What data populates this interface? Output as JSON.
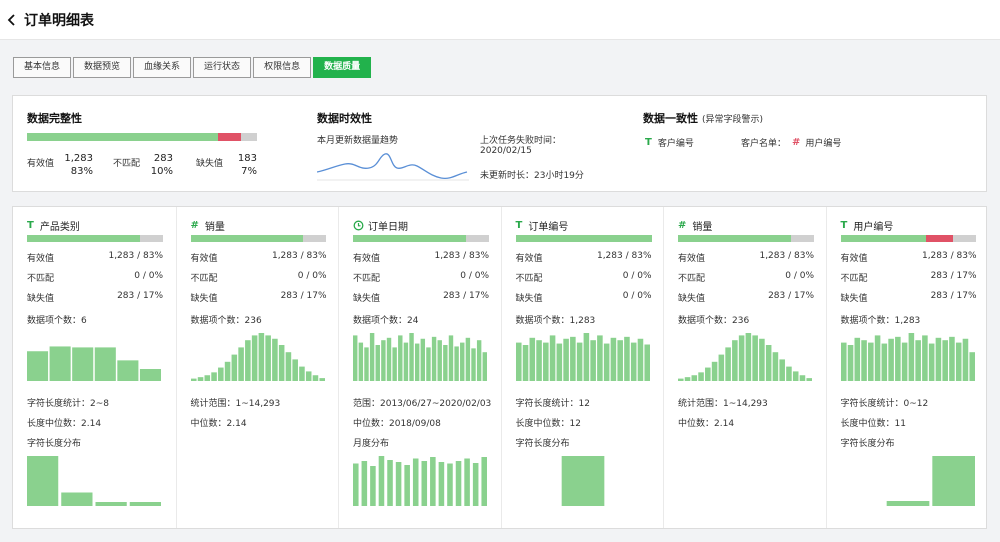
{
  "header": {
    "title": "订单明细表"
  },
  "tabs": [
    {
      "label": "基本信息",
      "active": false
    },
    {
      "label": "数据预览",
      "active": false
    },
    {
      "label": "血缘关系",
      "active": false
    },
    {
      "label": "运行状态",
      "active": false
    },
    {
      "label": "权限信息",
      "active": false
    },
    {
      "label": "数据质量",
      "active": true
    }
  ],
  "summary": {
    "completeness": {
      "title": "数据完整性",
      "bar": {
        "valid": 0.83,
        "mismatch": 0.1,
        "missing": 0.07
      },
      "valid_label": "有效值",
      "valid_count": "1,283",
      "valid_pct": "83%",
      "mismatch_label": "不匹配",
      "mismatch_count": "283",
      "mismatch_pct": "10%",
      "missing_label": "缺失值",
      "missing_count": "183",
      "missing_pct": "7%"
    },
    "timeliness": {
      "title": "数据时效性",
      "trend_label": "本月更新数据量趋势",
      "last_fail_label": "上次任务失败时间：",
      "last_fail_date": "2020/02/15",
      "not_updated": "未更新时长：23小时19分"
    },
    "consistency": {
      "title": "数据一致性",
      "subtitle": "(异常字段警示)",
      "field1": "客户编号",
      "pair_label": "客户名单：",
      "field2": "用户编号"
    }
  },
  "columns": [
    {
      "type": "T",
      "name": "产品类别",
      "bar": {
        "valid": 0.83,
        "mismatch": 0.0,
        "missing": 0.17
      },
      "valid_label": "有效值",
      "valid": "1,283 / 83%",
      "mismatch_label": "不匹配",
      "mismatch": "0 / 0%",
      "missing_label": "缺失值",
      "missing": "283 / 17%",
      "items_label": "数据项个数：",
      "items": "6",
      "hist": [
        0.62,
        0.72,
        0.7,
        0.7,
        0.43,
        0.25
      ],
      "stat1": "字符长度统计：2~8",
      "stat2": "长度中位数：2.14",
      "dist_label": "字符长度分布",
      "dist": [
        1.0,
        0.27,
        0.08,
        0.08
      ]
    },
    {
      "type": "#",
      "name": "销量",
      "bar": {
        "valid": 0.83,
        "mismatch": 0.0,
        "missing": 0.17
      },
      "valid_label": "有效值",
      "valid": "1,283 / 83%",
      "mismatch_label": "不匹配",
      "mismatch": "0 / 0%",
      "missing_label": "缺失值",
      "missing": "283 / 17%",
      "items_label": "数据项个数：",
      "items": "236",
      "hist": [
        0.05,
        0.08,
        0.12,
        0.18,
        0.28,
        0.4,
        0.55,
        0.7,
        0.85,
        0.95,
        1.0,
        0.95,
        0.88,
        0.75,
        0.6,
        0.45,
        0.3,
        0.2,
        0.12,
        0.06
      ],
      "stat1": "统计范围：1~14,293",
      "stat2": "中位数：2.14",
      "dist_label": "",
      "dist": []
    },
    {
      "type": "clock",
      "name": "订单日期",
      "bar": {
        "valid": 0.83,
        "mismatch": 0.0,
        "missing": 0.17
      },
      "valid_label": "有效值",
      "valid": "1,283 / 83%",
      "mismatch_label": "不匹配",
      "mismatch": "0 / 0%",
      "missing_label": "缺失值",
      "missing": "283 / 17%",
      "items_label": "数据项个数：",
      "items": "24",
      "hist": [
        0.95,
        0.8,
        0.7,
        1.0,
        0.75,
        0.85,
        0.9,
        0.7,
        0.95,
        0.8,
        1.0,
        0.78,
        0.88,
        0.7,
        0.92,
        0.85,
        0.75,
        0.95,
        0.72,
        0.8,
        0.9,
        0.68,
        0.85,
        0.6
      ],
      "stat1": "范围：2013/06/27~2020/02/03",
      "stat2": "中位数：2018/09/08",
      "dist_label": "月度分布",
      "dist": [
        0.85,
        0.9,
        0.8,
        1.0,
        0.92,
        0.88,
        0.82,
        0.95,
        0.9,
        0.98,
        0.88,
        0.85,
        0.9,
        0.95,
        0.86,
        0.98
      ]
    },
    {
      "type": "T",
      "name": "订单编号",
      "bar": {
        "valid": 1.0,
        "mismatch": 0.0,
        "missing": 0.0
      },
      "valid_label": "有效值",
      "valid": "1,283 / 83%",
      "mismatch_label": "不匹配",
      "mismatch": "0 / 0%",
      "missing_label": "缺失值",
      "missing": "0 / 0%",
      "items_label": "数据项个数：",
      "items": "1,283",
      "hist": [
        0.8,
        0.75,
        0.9,
        0.85,
        0.8,
        0.95,
        0.78,
        0.88,
        0.92,
        0.8,
        1.0,
        0.85,
        0.95,
        0.78,
        0.9,
        0.85,
        0.92,
        0.8,
        0.88,
        0.76
      ],
      "stat1": "字符长度统计：12",
      "stat2": "长度中位数：12",
      "dist_label": "字符长度分布",
      "dist": [
        0.0,
        1.0,
        0.0
      ]
    },
    {
      "type": "#",
      "name": "销量",
      "bar": {
        "valid": 0.83,
        "mismatch": 0.0,
        "missing": 0.17
      },
      "valid_label": "有效值",
      "valid": "1,283 / 83%",
      "mismatch_label": "不匹配",
      "mismatch": "0 / 0%",
      "missing_label": "缺失值",
      "missing": "283 / 17%",
      "items_label": "数据项个数：",
      "items": "236",
      "hist": [
        0.05,
        0.08,
        0.12,
        0.18,
        0.28,
        0.4,
        0.55,
        0.7,
        0.85,
        0.95,
        1.0,
        0.95,
        0.88,
        0.75,
        0.6,
        0.45,
        0.3,
        0.2,
        0.12,
        0.06
      ],
      "stat1": "统计范围：1~14,293",
      "stat2": "中位数：2.14",
      "dist_label": "",
      "dist": []
    },
    {
      "type": "T",
      "name": "用户编号",
      "bar": {
        "valid": 0.63,
        "mismatch": 0.2,
        "missing": 0.17
      },
      "valid_label": "有效值",
      "valid": "1,283 / 83%",
      "mismatch_label": "不匹配",
      "mismatch": "283 / 17%",
      "missing_label": "缺失值",
      "missing": "283 / 17%",
      "items_label": "数据项个数：",
      "items": "1,283",
      "hist": [
        0.8,
        0.75,
        0.9,
        0.85,
        0.8,
        0.95,
        0.78,
        0.88,
        0.92,
        0.8,
        1.0,
        0.85,
        0.95,
        0.78,
        0.9,
        0.85,
        0.92,
        0.8,
        0.88,
        0.6
      ],
      "stat1": "字符长度统计：0~12",
      "stat2": "长度中位数：11",
      "dist_label": "字符长度分布",
      "dist": [
        0.0,
        0.1,
        1.0
      ]
    }
  ],
  "colors": {
    "green": "#8ad18e",
    "red": "#e05266",
    "gray": "#d0d0d0",
    "accent": "#22b24c",
    "trend": "#5a8fd6"
  }
}
